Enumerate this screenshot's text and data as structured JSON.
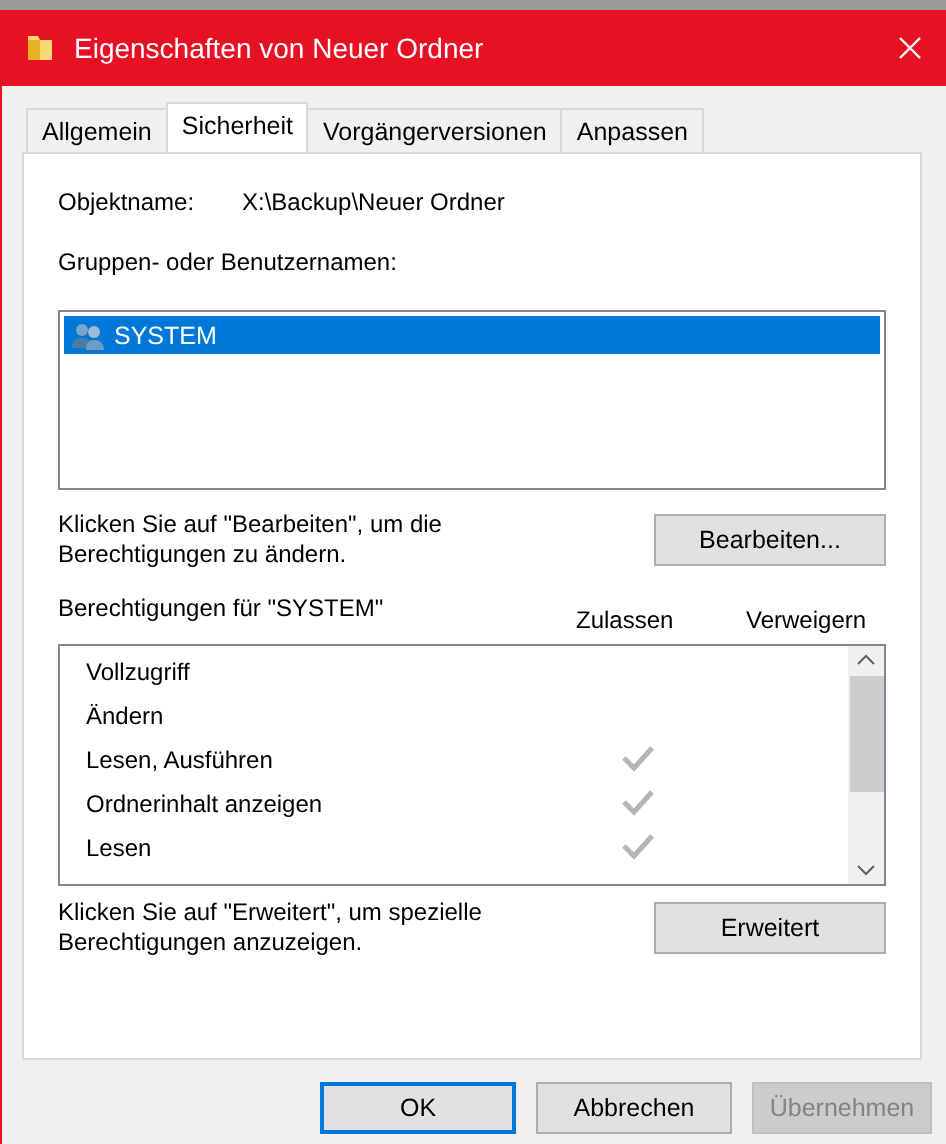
{
  "window": {
    "title": "Eigenschaften von Neuer Ordner"
  },
  "tabs": [
    {
      "label": "Allgemein",
      "selected": false
    },
    {
      "label": "Sicherheit",
      "selected": true
    },
    {
      "label": "Vorgängerversionen",
      "selected": false
    },
    {
      "label": "Anpassen",
      "selected": false
    }
  ],
  "object_name": {
    "label": "Objektname:",
    "value": "X:\\Backup\\Neuer Ordner"
  },
  "groups": {
    "label": "Gruppen- oder Benutzernamen:",
    "items": [
      {
        "name": "SYSTEM",
        "selected": true
      }
    ]
  },
  "edit_hint": "Klicken Sie auf \"Bearbeiten\", um die Berechtigungen zu ändern.",
  "edit_button": "Bearbeiten...",
  "permissions": {
    "label": "Berechtigungen für \"SYSTEM\"",
    "allow_header": "Zulassen",
    "deny_header": "Verweigern",
    "rows": [
      {
        "name": "Vollzugriff",
        "allow": false,
        "deny": false
      },
      {
        "name": "Ändern",
        "allow": false,
        "deny": false
      },
      {
        "name": "Lesen, Ausführen",
        "allow": true,
        "deny": false
      },
      {
        "name": "Ordnerinhalt anzeigen",
        "allow": true,
        "deny": false
      },
      {
        "name": "Lesen",
        "allow": true,
        "deny": false
      }
    ]
  },
  "advanced_hint": "Klicken Sie auf \"Erweitert\", um spezielle Berechtigungen anzuzeigen.",
  "advanced_button": "Erweitert",
  "buttons": [
    {
      "label": "OK",
      "kind": "default",
      "disabled": false
    },
    {
      "label": "Abbrechen",
      "kind": "normal",
      "disabled": false
    },
    {
      "label": "Übernehmen",
      "kind": "normal",
      "disabled": true
    }
  ]
}
